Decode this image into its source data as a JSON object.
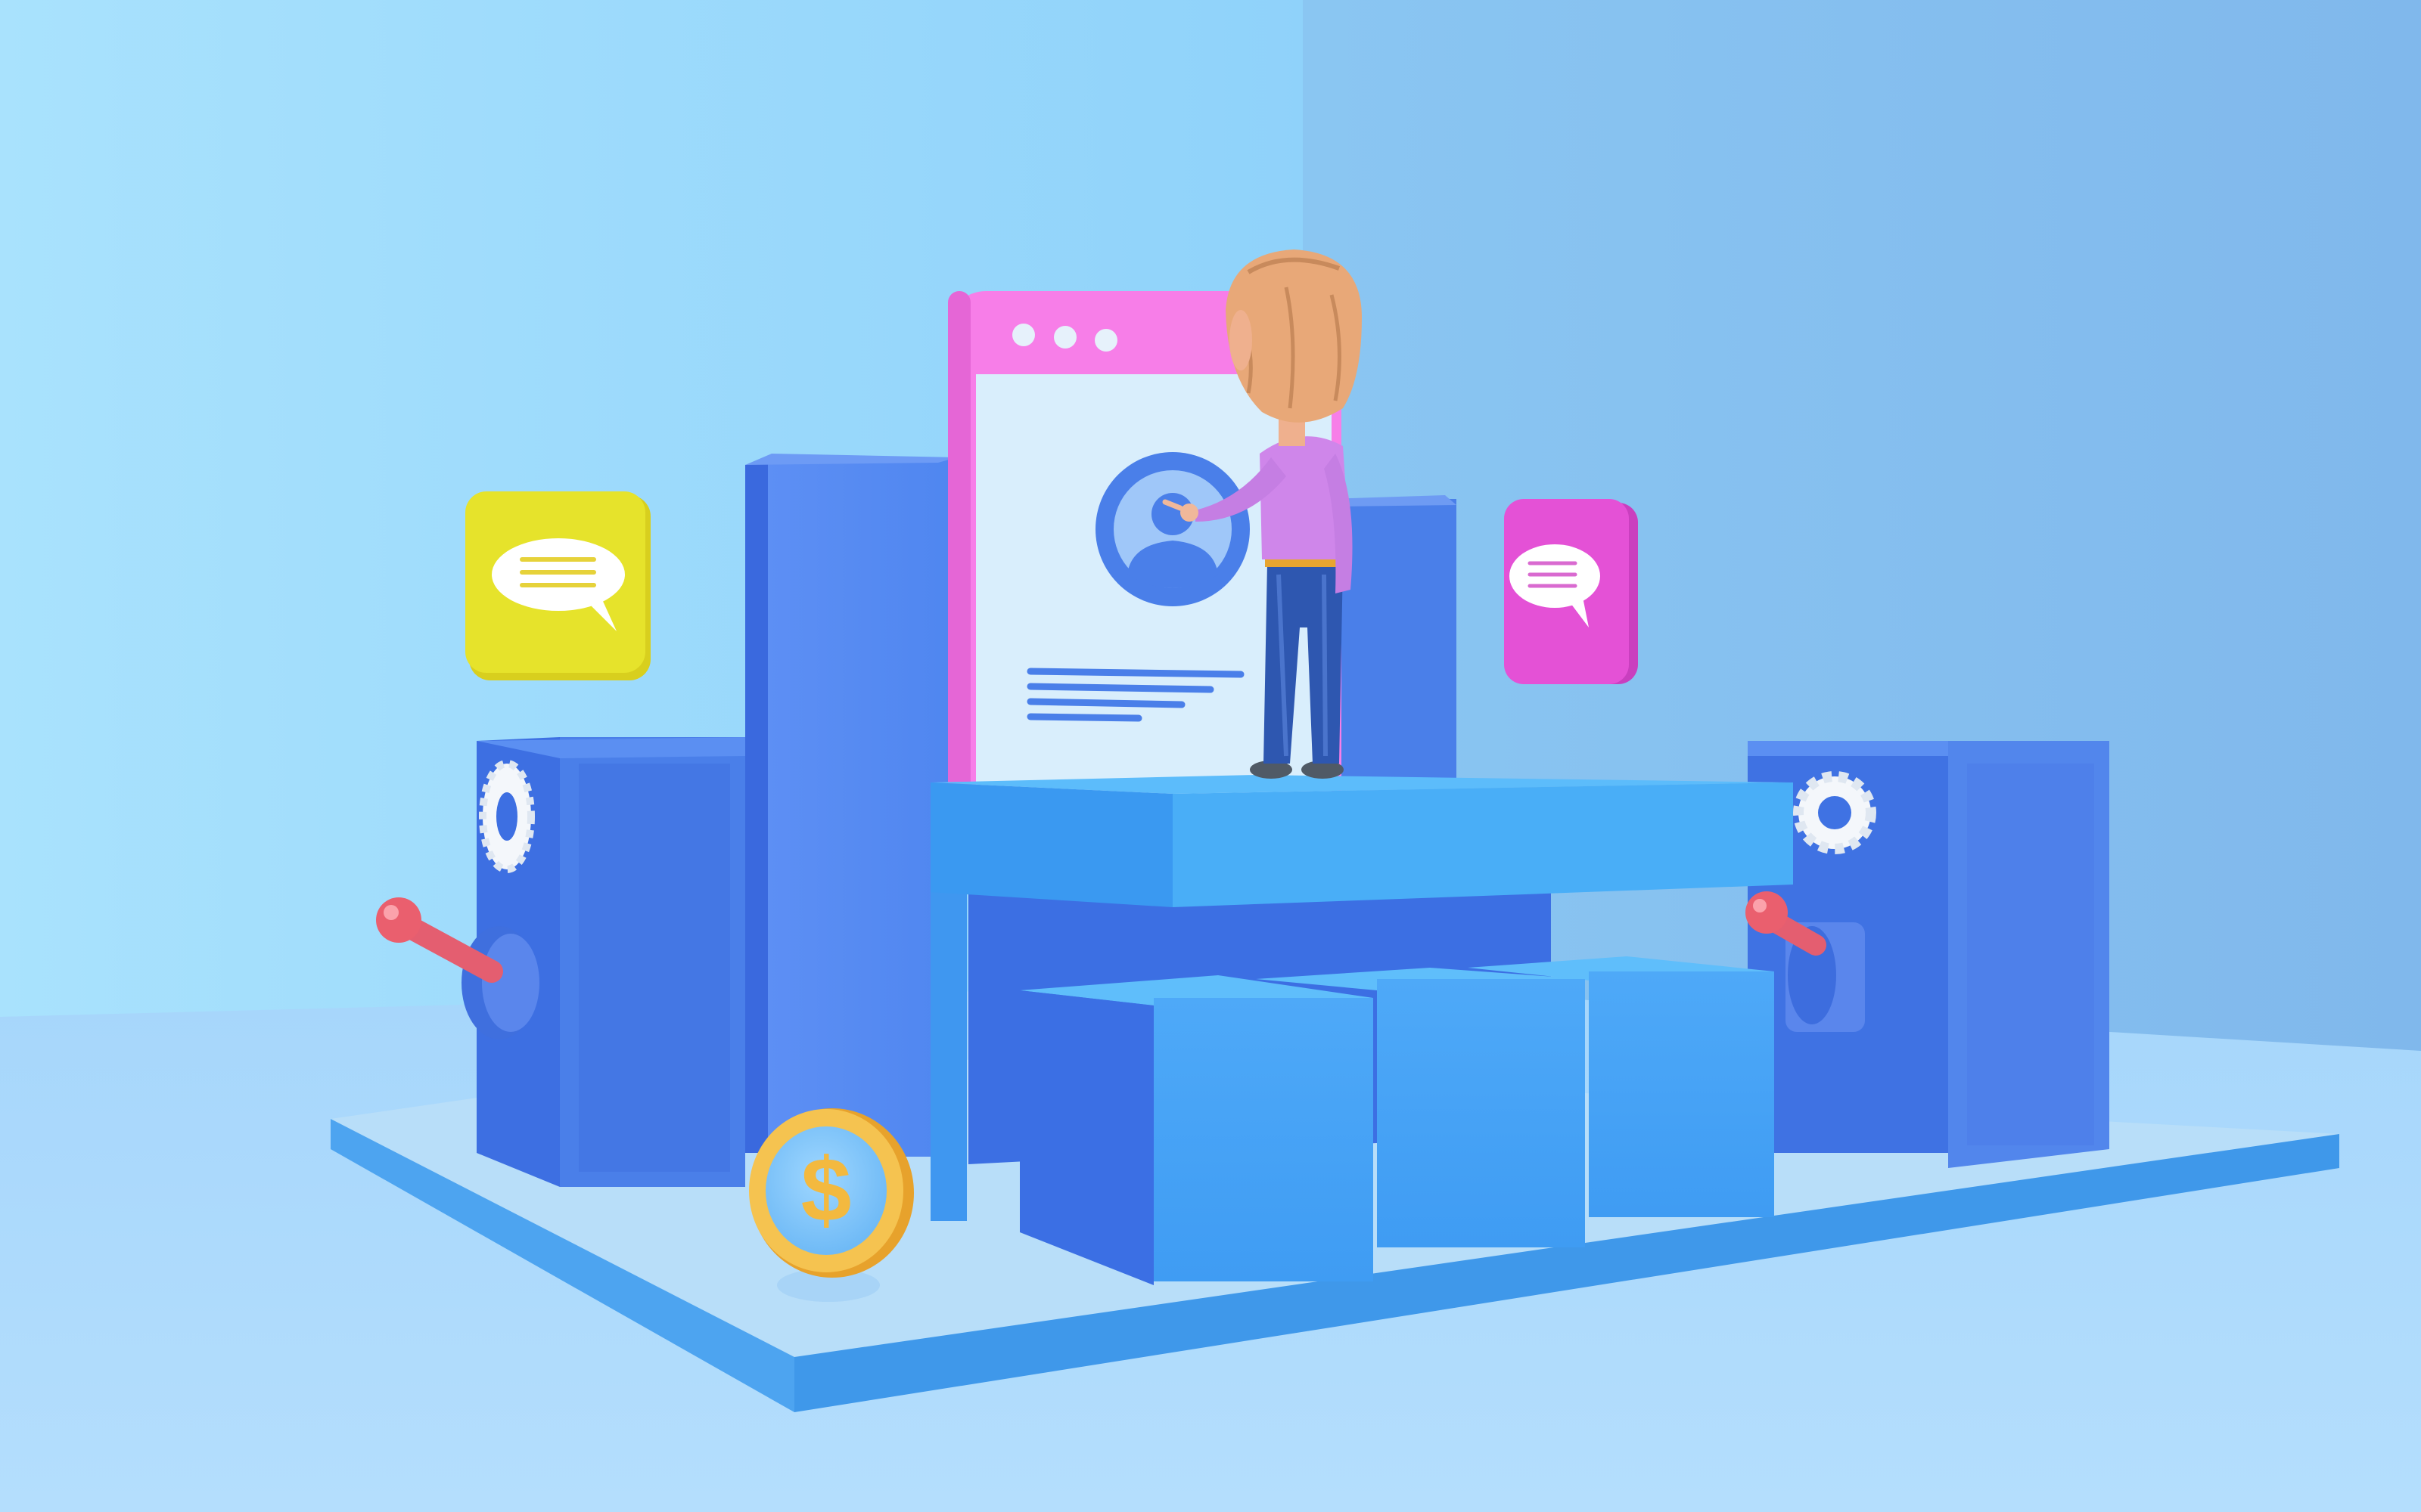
{
  "scene": {
    "coin_symbol": "$"
  },
  "palette": {
    "wall_left": "#9fdcfb",
    "wall_right": "#86c0f0",
    "floor": "#a9d8fb",
    "platform": "#4aa7f2",
    "block_dark": "#3f73e6",
    "block_light": "#49a8f6",
    "phone_frame": "#f77ee8",
    "phone_screen": "#d9eefc",
    "yellow_bubble": "#e6e32b",
    "pink_bubble": "#e451d6",
    "coin": "#f5b840",
    "shirt": "#cf86ea",
    "jeans": "#2e57b0",
    "hair": "#e8a878",
    "lever": "#ee5a6a"
  }
}
